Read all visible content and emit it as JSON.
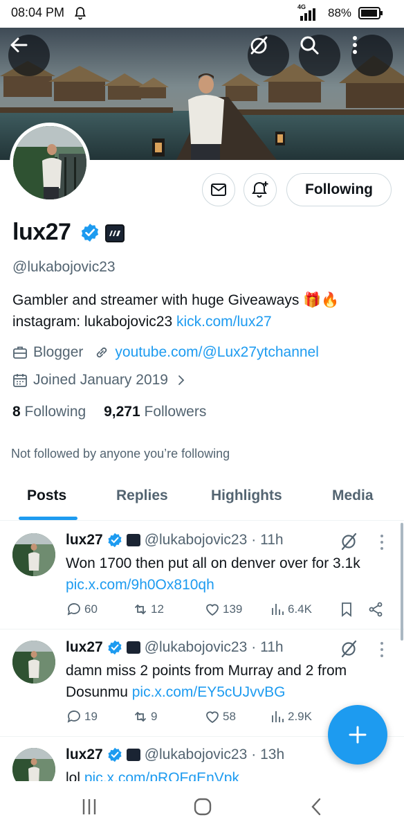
{
  "status_bar": {
    "time": "08:04 PM",
    "network": "4G",
    "battery": "88%"
  },
  "profile": {
    "display_name": "lux27",
    "handle": "@lukabojovic23",
    "bio_line1": "Gambler and streamer  with huge Giveaways 🎁🔥",
    "bio_line2_text": "instagram: lukabojovic23 ",
    "bio_link": "kick.com/lux27",
    "category": "Blogger",
    "website": "youtube.com/@Lux27ytchannel",
    "joined": "Joined January 2019",
    "following_count": "8",
    "following_label": "Following",
    "followers_count": "9,271",
    "followers_label": "Followers",
    "not_followed_text": "Not followed by anyone you’re following",
    "following_button": "Following"
  },
  "tabs": [
    {
      "label": "Posts",
      "active": true
    },
    {
      "label": "Replies",
      "active": false
    },
    {
      "label": "Highlights",
      "active": false
    },
    {
      "label": "Media",
      "active": false
    }
  ],
  "posts": [
    {
      "name": "lux27",
      "handle": "@lukabojovic23",
      "time": "· 11h",
      "text": "Won 1700 then put all on denver over for 3.1k ",
      "link": "pic.x.com/9h0Ox810qh",
      "replies": "60",
      "reposts": "12",
      "likes": "139",
      "views": "6.4K"
    },
    {
      "name": "lux27",
      "handle": "@lukabojovic23",
      "time": "· 11h",
      "text": "damn miss 2 points from Murray and 2 from Dosunmu ",
      "link": "pic.x.com/EY5cUJvvBG",
      "replies": "19",
      "reposts": "9",
      "likes": "58",
      "views": "2.9K"
    },
    {
      "name": "lux27",
      "handle": "@lukabojovic23",
      "time": "· 13h",
      "text": "lol ",
      "link": "pic.x.com/pROFqEnVpk"
    }
  ],
  "colors": {
    "accent": "#1d9bf0",
    "text_primary": "#0f1419",
    "text_secondary": "#536471"
  }
}
